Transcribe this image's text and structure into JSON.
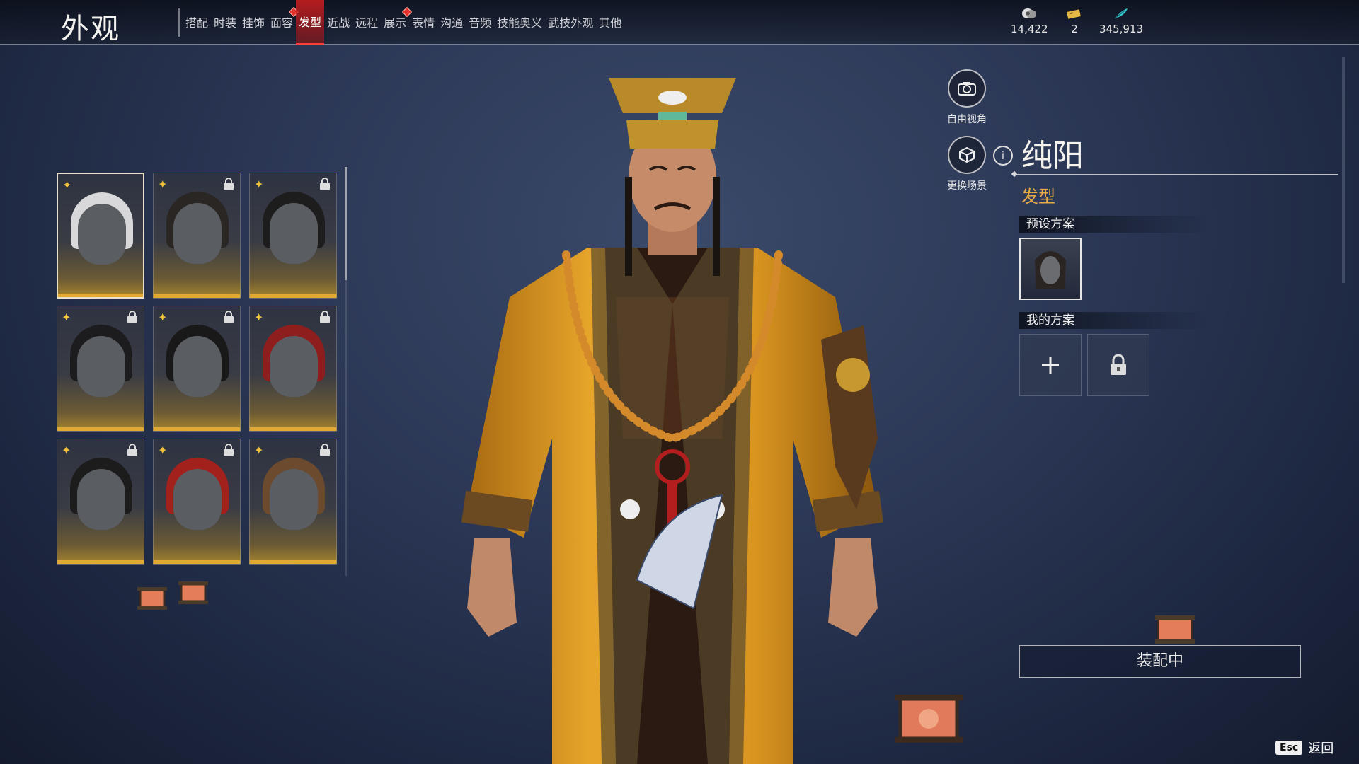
{
  "header": {
    "title": "外观",
    "tabs": [
      {
        "label": "搭配",
        "active": false,
        "badge": false
      },
      {
        "label": "时装",
        "active": false,
        "badge": false
      },
      {
        "label": "挂饰",
        "active": false,
        "badge": false
      },
      {
        "label": "面容",
        "active": false,
        "badge": true
      },
      {
        "label": "发型",
        "active": true,
        "badge": false
      },
      {
        "label": "近战",
        "active": false,
        "badge": false
      },
      {
        "label": "远程",
        "active": false,
        "badge": false
      },
      {
        "label": "展示",
        "active": false,
        "badge": true
      },
      {
        "label": "表情",
        "active": false,
        "badge": false
      },
      {
        "label": "沟通",
        "active": false,
        "badge": false
      },
      {
        "label": "音频",
        "active": false,
        "badge": false
      },
      {
        "label": "技能奥义",
        "active": false,
        "badge": false
      },
      {
        "label": "武技外观",
        "active": false,
        "badge": false
      },
      {
        "label": "其他",
        "active": false,
        "badge": false
      }
    ],
    "currencies": [
      {
        "icon": "coin-icon",
        "value": "14,422"
      },
      {
        "icon": "ticket-icon",
        "value": "2"
      },
      {
        "icon": "feather-icon",
        "value": "345,913"
      }
    ]
  },
  "hair_grid": [
    {
      "color": "#d8d8da",
      "locked": false,
      "selected": true
    },
    {
      "color": "#2a2624",
      "locked": true,
      "selected": false
    },
    {
      "color": "#1e1d1e",
      "locked": true,
      "selected": false
    },
    {
      "color": "#1c1b1d",
      "locked": true,
      "selected": false
    },
    {
      "color": "#1a1919",
      "locked": true,
      "selected": false
    },
    {
      "color": "#8e1e1e",
      "locked": true,
      "selected": false
    },
    {
      "color": "#1d1c1c",
      "locked": true,
      "selected": false
    },
    {
      "color": "#a3211d",
      "locked": true,
      "selected": false
    },
    {
      "color": "#6b4a2e",
      "locked": true,
      "selected": false
    }
  ],
  "view_controls": {
    "free_view_label": "自由视角",
    "change_scene_label": "更换场景"
  },
  "panel": {
    "school": "纯阳",
    "category": "发型",
    "preset_header": "预设方案",
    "my_header": "我的方案",
    "equip_label": "装配中"
  },
  "footer": {
    "esc_key": "Esc",
    "back_label": "返回"
  },
  "colors": {
    "accent_red": "#e0322b",
    "gold": "#e2a934",
    "category_orange": "#e8a948"
  }
}
